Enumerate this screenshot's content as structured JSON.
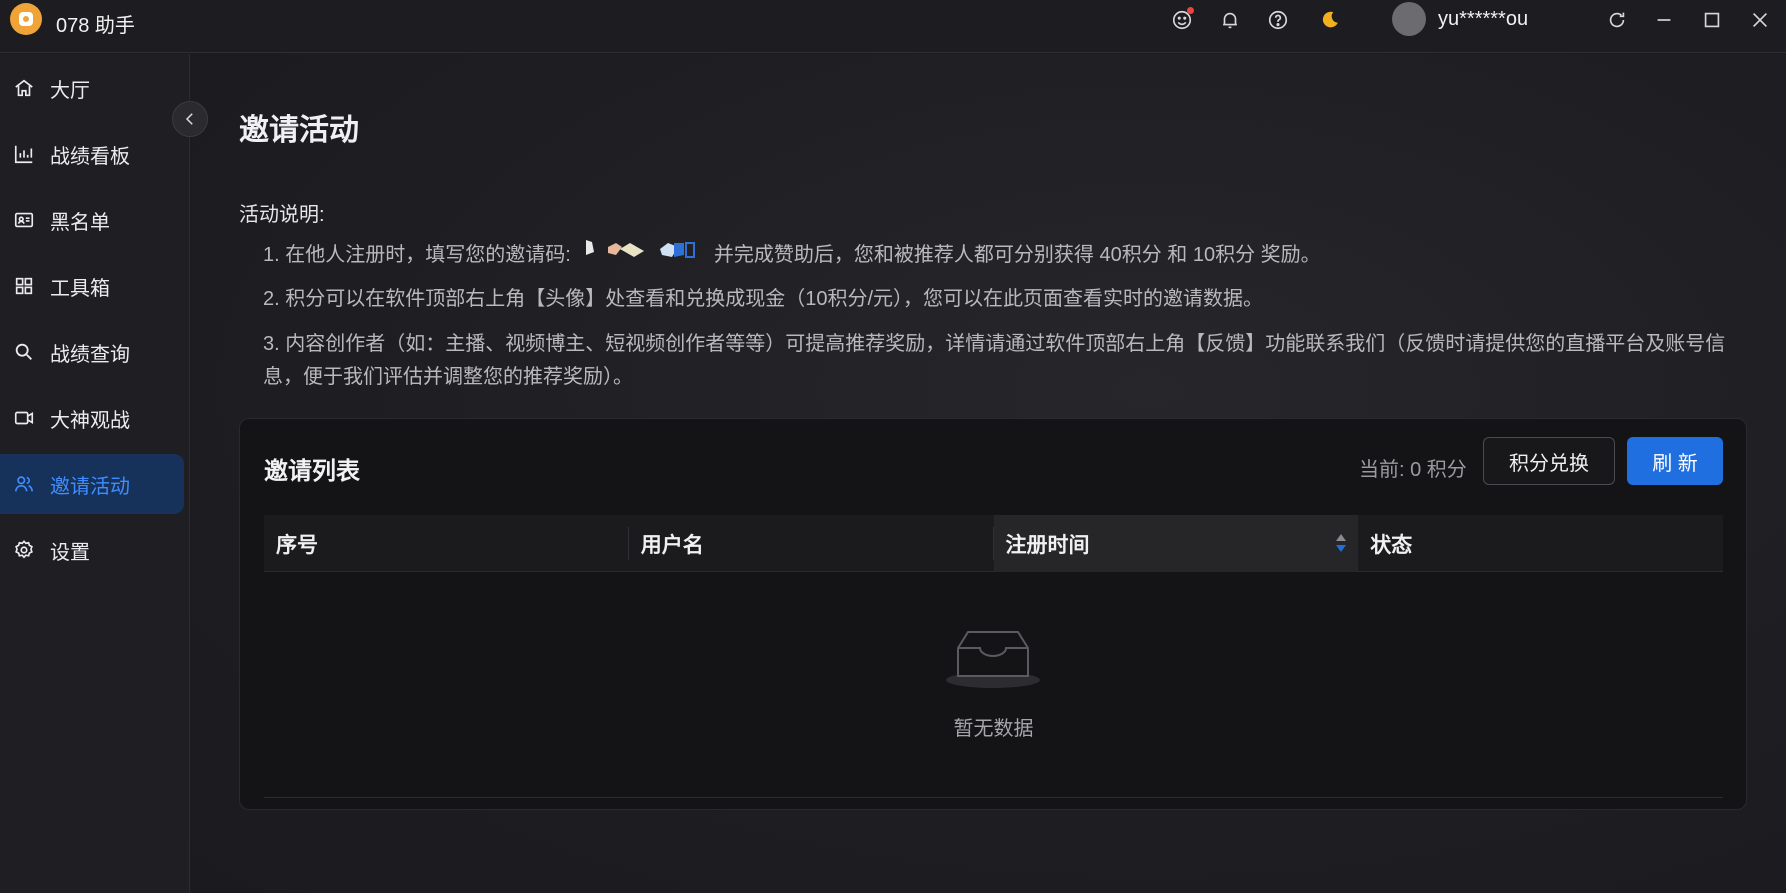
{
  "app": {
    "title": "078 助手",
    "username": "yu******ou"
  },
  "sidebar": {
    "items": [
      {
        "label": "大厅",
        "icon": "home-icon"
      },
      {
        "label": "战绩看板",
        "icon": "bar-chart-icon"
      },
      {
        "label": "黑名单",
        "icon": "id-card-icon"
      },
      {
        "label": "工具箱",
        "icon": "grid-icon"
      },
      {
        "label": "战绩查询",
        "icon": "search-icon"
      },
      {
        "label": "大神观战",
        "icon": "video-icon"
      },
      {
        "label": "邀请活动",
        "icon": "users-icon",
        "active": true
      },
      {
        "label": "设置",
        "icon": "gear-icon"
      }
    ]
  },
  "page": {
    "title": "邀请活动",
    "desc_head": "活动说明:",
    "line1_prefix": "1. 在他人注册时，填写您的邀请码:",
    "line1_suffix": "并完成赞助后，您和被推荐人都可分别获得 40积分 和  10积分 奖励。",
    "line2": "2. 积分可以在软件顶部右上角【头像】处查看和兑换成现金（10积分/元），您可以在此页面查看实时的邀请数据。",
    "line3": "3. 内容创作者（如：主播、视频博主、短视频创作者等等）可提高推荐奖励，详情请通过软件顶部右上角【反馈】功能联系我们（反馈时请提供您的直播平台及账号信息，便于我们评估并调整您的推荐奖励）。"
  },
  "card": {
    "title": "邀请列表",
    "points": "当前: 0 积分",
    "exchange_label": "积分兑换",
    "refresh_label": "刷 新",
    "columns": [
      "序号",
      "用户名",
      "注册时间",
      "状态"
    ],
    "empty_text": "暂无数据"
  },
  "colors": {
    "accent": "#1f6fe0",
    "active_nav_bg": "#17325a",
    "active_nav_text": "#3f8dff",
    "logo": "#f0a437"
  }
}
